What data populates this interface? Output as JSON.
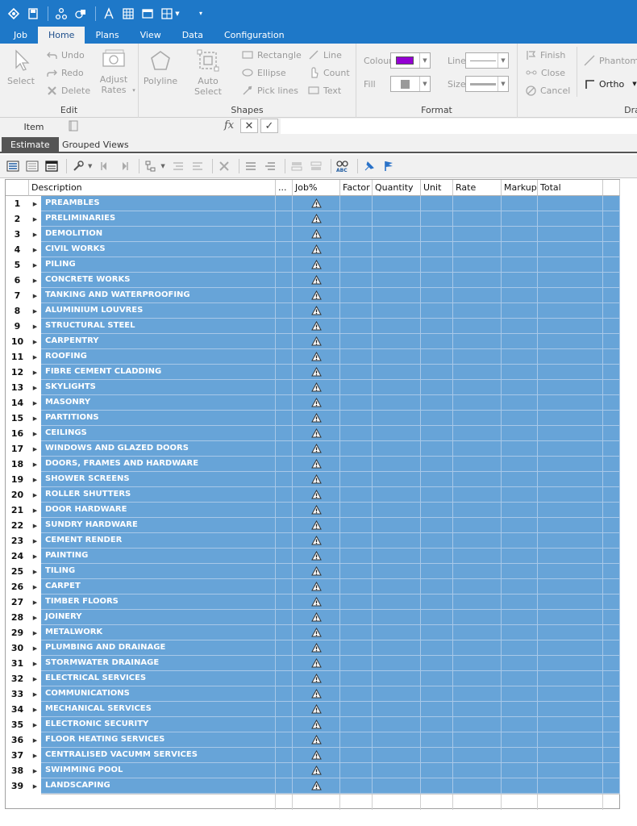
{
  "ribbon_tabs": [
    {
      "label": "Job",
      "active": false
    },
    {
      "label": "Home",
      "active": true
    },
    {
      "label": "Plans",
      "active": false
    },
    {
      "label": "View",
      "active": false
    },
    {
      "label": "Data",
      "active": false
    },
    {
      "label": "Configuration",
      "active": false
    }
  ],
  "groups": {
    "edit": {
      "label": "Edit",
      "select": "Select",
      "undo": "Undo",
      "redo": "Redo",
      "delete": "Delete",
      "adjust_rates": "Adjust Rates"
    },
    "shapes": {
      "label": "Shapes",
      "polyline": "Polyline",
      "auto_select": "Auto Select",
      "rectangle": "Rectangle",
      "ellipse": "Ellipse",
      "pick_lines": "Pick lines",
      "line": "Line",
      "count": "Count",
      "text": "Text"
    },
    "format": {
      "label": "Format",
      "colour": "Colour",
      "fill": "Fill",
      "line": "Line",
      "size": "Size",
      "colour_value": "#9400d3",
      "fill_value": "#9a9a9a"
    },
    "draw": {
      "label": "Dra",
      "finish": "Finish",
      "close": "Close",
      "cancel": "Cancel",
      "phantom": "Phantom",
      "ortho": "Ortho"
    }
  },
  "formula_bar": {
    "cell_name": "Item",
    "fx": "fx",
    "cancel": "✕",
    "accept": "✓",
    "value": ""
  },
  "view_tabs": [
    {
      "label": "Estimate",
      "active": true
    },
    {
      "label": "Grouped Views",
      "active": false
    }
  ],
  "columns": [
    "Description",
    "...",
    "Job%",
    "Factor",
    "Quantity",
    "Unit",
    "Rate",
    "Markup",
    "Total"
  ],
  "colors": {
    "accent": "#1e78c8",
    "selected_row": "#67a4d8"
  },
  "rows": [
    {
      "num": "1",
      "desc": "PREAMBLES"
    },
    {
      "num": "2",
      "desc": "PRELIMINARIES"
    },
    {
      "num": "3",
      "desc": "DEMOLITION"
    },
    {
      "num": "4",
      "desc": "CIVIL WORKS"
    },
    {
      "num": "5",
      "desc": "PILING"
    },
    {
      "num": "6",
      "desc": "CONCRETE WORKS"
    },
    {
      "num": "7",
      "desc": "TANKING AND WATERPROOFING"
    },
    {
      "num": "8",
      "desc": "ALUMINIUM LOUVRES"
    },
    {
      "num": "9",
      "desc": "STRUCTURAL STEEL"
    },
    {
      "num": "10",
      "desc": "CARPENTRY"
    },
    {
      "num": "11",
      "desc": "ROOFING"
    },
    {
      "num": "12",
      "desc": "FIBRE CEMENT CLADDING"
    },
    {
      "num": "13",
      "desc": "SKYLIGHTS"
    },
    {
      "num": "14",
      "desc": "MASONRY"
    },
    {
      "num": "15",
      "desc": "PARTITIONS"
    },
    {
      "num": "16",
      "desc": "CEILINGS"
    },
    {
      "num": "17",
      "desc": "WINDOWS AND GLAZED DOORS"
    },
    {
      "num": "18",
      "desc": "DOORS, FRAMES AND HARDWARE"
    },
    {
      "num": "19",
      "desc": "SHOWER SCREENS"
    },
    {
      "num": "20",
      "desc": "ROLLER SHUTTERS"
    },
    {
      "num": "21",
      "desc": "DOOR HARDWARE"
    },
    {
      "num": "22",
      "desc": "SUNDRY HARDWARE"
    },
    {
      "num": "23",
      "desc": "CEMENT RENDER"
    },
    {
      "num": "24",
      "desc": "PAINTING"
    },
    {
      "num": "25",
      "desc": "TILING"
    },
    {
      "num": "26",
      "desc": "CARPET"
    },
    {
      "num": "27",
      "desc": "TIMBER FLOORS"
    },
    {
      "num": "28",
      "desc": "JOINERY"
    },
    {
      "num": "29",
      "desc": "METALWORK"
    },
    {
      "num": "30",
      "desc": "PLUMBING AND DRAINAGE"
    },
    {
      "num": "31",
      "desc": "STORMWATER DRAINAGE"
    },
    {
      "num": "32",
      "desc": "ELECTRICAL SERVICES"
    },
    {
      "num": "33",
      "desc": "COMMUNICATIONS"
    },
    {
      "num": "34",
      "desc": "MECHANICAL SERVICES"
    },
    {
      "num": "35",
      "desc": "ELECTRONIC SECURITY"
    },
    {
      "num": "36",
      "desc": "FLOOR HEATING SERVICES"
    },
    {
      "num": "37",
      "desc": "CENTRALISED VACUMM SERVICES"
    },
    {
      "num": "38",
      "desc": "SWIMMING POOL"
    },
    {
      "num": "39",
      "desc": "LANDSCAPING"
    }
  ]
}
